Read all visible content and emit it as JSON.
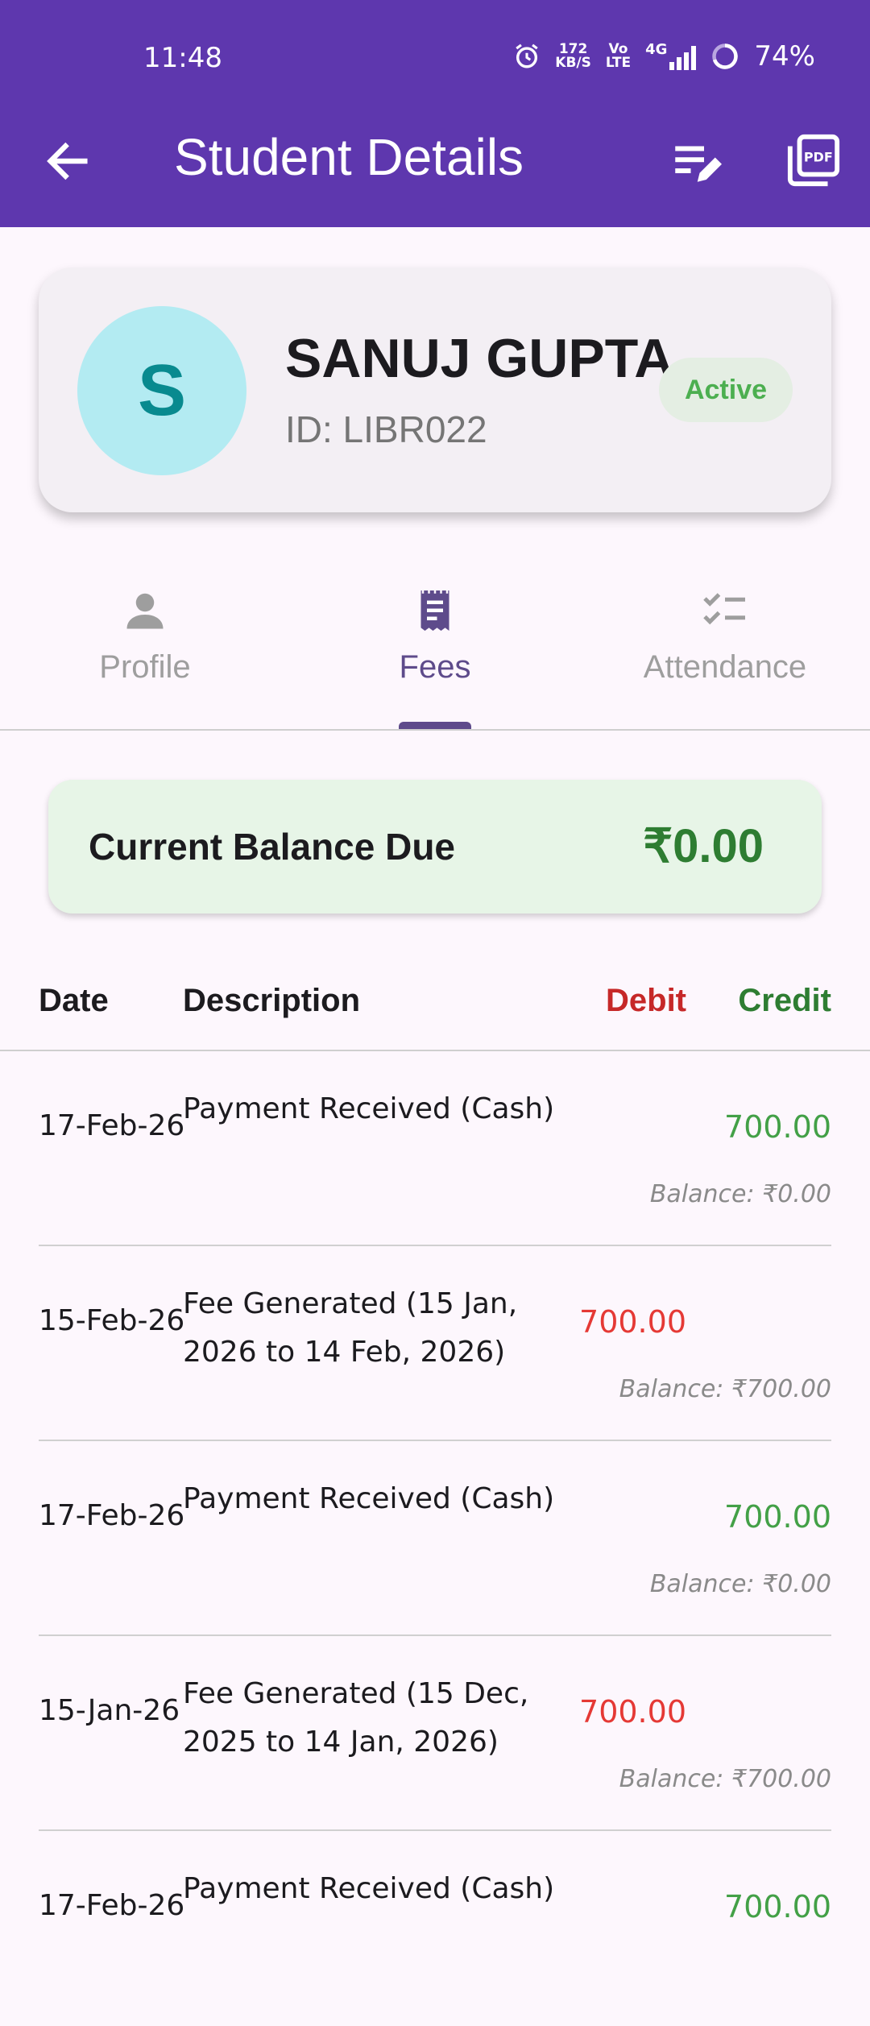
{
  "status_bar": {
    "time": "11:48",
    "net_speed_top": "172",
    "net_speed_bottom": "KB/S",
    "volte_top": "Vo",
    "volte_bottom": "LTE",
    "network": "4G",
    "battery": "74%"
  },
  "appbar": {
    "title": "Student Details",
    "back_icon": "arrow-back-icon",
    "edit_icon": "edit-list-icon",
    "pdf_icon": "pdf-icon",
    "pdf_label": "PDF",
    "color": "#5e37ae"
  },
  "student": {
    "initial": "S",
    "name": "SANUJ GUPTA",
    "id": "ID: LIBR022",
    "status": "Active"
  },
  "tabs": [
    {
      "label": "Profile",
      "icon": "person-icon",
      "active": false
    },
    {
      "label": "Fees",
      "icon": "receipt-icon",
      "active": true
    },
    {
      "label": "Attendance",
      "icon": "checklist-icon",
      "active": false
    }
  ],
  "balance": {
    "label": "Current Balance Due",
    "value": "₹0.00"
  },
  "ledger": {
    "headers": {
      "date": "Date",
      "description": "Description",
      "debit": "Debit",
      "credit": "Credit"
    },
    "rows": [
      {
        "date": "17-Feb-26",
        "description": "Payment Received (Cash)",
        "debit": "",
        "credit": "700.00",
        "balance": "Balance: ₹0.00"
      },
      {
        "date": "15-Feb-26",
        "description": "Fee Generated (15 Jan, 2026 to 14 Feb, 2026)",
        "debit": "700.00",
        "credit": "",
        "balance": "Balance: ₹700.00"
      },
      {
        "date": "17-Feb-26",
        "description": "Payment Received (Cash)",
        "debit": "",
        "credit": "700.00",
        "balance": "Balance: ₹0.00"
      },
      {
        "date": "15-Jan-26",
        "description": "Fee Generated (15 Dec, 2025 to 14 Jan, 2026)",
        "debit": "700.00",
        "credit": "",
        "balance": "Balance: ₹700.00"
      },
      {
        "date": "17-Feb-26",
        "description": "Payment Received (Cash)",
        "debit": "",
        "credit": "700.00",
        "balance": ""
      }
    ]
  }
}
